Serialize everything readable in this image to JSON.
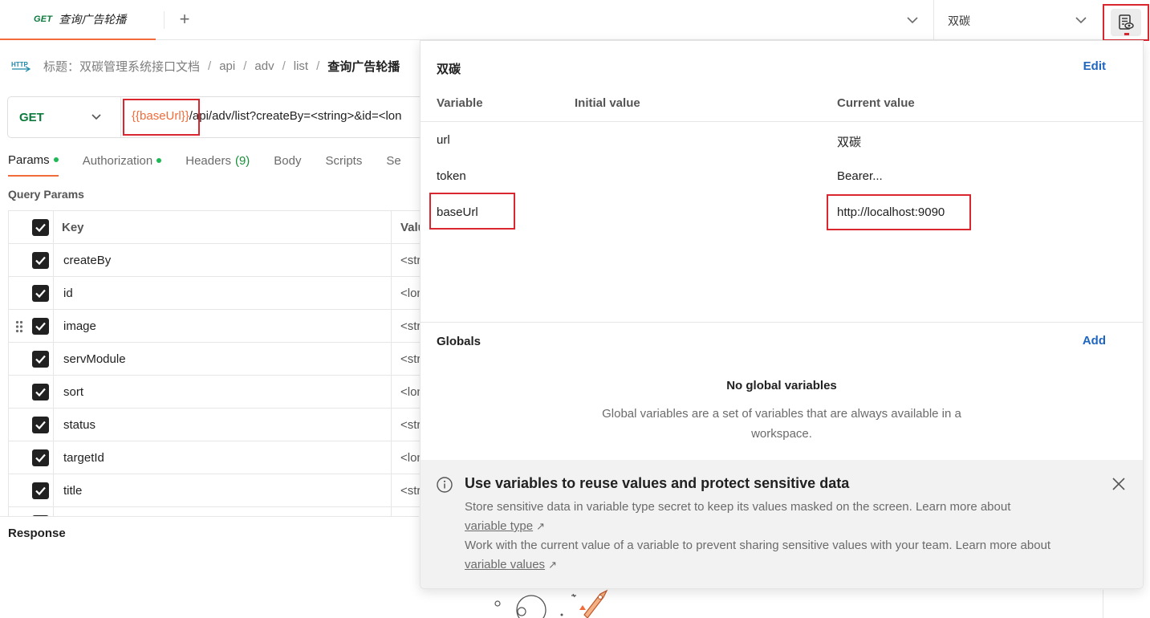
{
  "tab": {
    "method": "GET",
    "name": "查询广告轮播"
  },
  "env": {
    "selected": "双碳"
  },
  "breadcrumb": {
    "icon_label": "HTTP",
    "items": [
      "标题：双碳管理系统接口文档",
      "api",
      "adv",
      "list"
    ],
    "current": "查询广告轮播",
    "sep": "/"
  },
  "request": {
    "method": "GET",
    "url_var": "{{baseUrl}}",
    "url_rest": "/api/adv/list?createBy=<string>&id=<lon"
  },
  "req_tabs": {
    "params": "Params",
    "authorization": "Authorization",
    "headers": "Headers",
    "headers_count": "(9)",
    "body": "Body",
    "scripts": "Scripts",
    "settings": "Se"
  },
  "query_params": {
    "title": "Query Params",
    "col_key": "Key",
    "col_value": "Valu",
    "rows": [
      {
        "key": "createBy",
        "value": "<str"
      },
      {
        "key": "id",
        "value": "<lon"
      },
      {
        "key": "image",
        "value": "<str"
      },
      {
        "key": "servModule",
        "value": "<str"
      },
      {
        "key": "sort",
        "value": "<lon"
      },
      {
        "key": "status",
        "value": "<str"
      },
      {
        "key": "targetId",
        "value": "<lon"
      },
      {
        "key": "title",
        "value": "<str"
      }
    ]
  },
  "response": {
    "label": "Response"
  },
  "popover": {
    "env_name": "双碳",
    "edit_label": "Edit",
    "col_variable": "Variable",
    "col_initial": "Initial value",
    "col_current": "Current value",
    "variables": [
      {
        "name": "url",
        "current": "双碳"
      },
      {
        "name": "token",
        "current": "Bearer..."
      },
      {
        "name": "baseUrl",
        "current": "http://localhost:9090"
      }
    ],
    "globals_title": "Globals",
    "add_label": "Add",
    "no_globals": "No global variables",
    "globals_desc": "Global variables are a set of variables that are always available in a workspace.",
    "info": {
      "title": "Use variables to reuse values and protect sensitive data",
      "p1": "Store sensitive data in variable type secret to keep its values masked on the screen. Learn more about",
      "p1_link": "variable type",
      "p2": "Work with the current value of a variable to prevent sharing sensitive values with your team. Learn more about",
      "p2_link": "variable values",
      "arrow": "↗"
    }
  },
  "colors": {
    "accent": "#f26b3a",
    "get": "#0b7a3b",
    "link": "#1f66c1",
    "highlight": "#d9262f",
    "dot": "#1db954"
  }
}
